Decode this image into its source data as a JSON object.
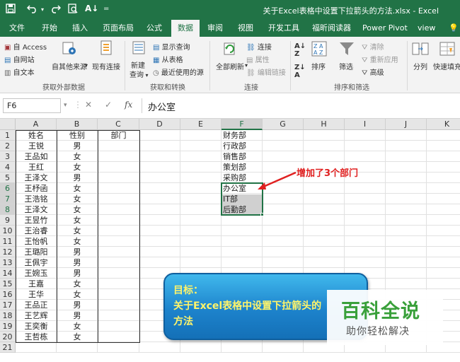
{
  "titlebar": {
    "title": "关于Excel表格中设置下拉箭头的方法.xlsx  -  Excel",
    "save_icon": "save-icon",
    "undo_icon": "undo-icon",
    "redo_icon": "redo-icon",
    "preview_icon": "print-preview-icon",
    "sort_icon": "sort-icon"
  },
  "tabs": [
    {
      "label": "文件"
    },
    {
      "label": "开始"
    },
    {
      "label": "插入"
    },
    {
      "label": "页面布局"
    },
    {
      "label": "公式"
    },
    {
      "label": "数据",
      "active": true
    },
    {
      "label": "审阅"
    },
    {
      "label": "视图"
    },
    {
      "label": "开发工具"
    },
    {
      "label": "福昕阅读器"
    },
    {
      "label": "Power Pivot"
    },
    {
      "label": "view"
    }
  ],
  "ribbon": {
    "get_external": {
      "access": "自 Access",
      "web": "自网站",
      "text": "自文本",
      "other": "自其他来源",
      "existing": "现有连接",
      "group": "获取外部数据"
    },
    "transform": {
      "new_query_1": "新建",
      "new_query_2": "查询",
      "show_queries": "显示查询",
      "from_table": "从表格",
      "recent_sources": "最近使用的源",
      "group": "获取和转换"
    },
    "connections": {
      "refresh_all": "全部刷新",
      "connections": "连接",
      "properties": "属性",
      "edit_links": "编辑链接",
      "group": "连接"
    },
    "sort_filter": {
      "sort": "排序",
      "filter": "筛选",
      "clear": "清除",
      "reapply": "重新应用",
      "advanced": "高级",
      "group": "排序和筛选"
    },
    "tools": {
      "split": "分列",
      "flash_fill": "快速填充"
    }
  },
  "formula_bar": {
    "name_box": "F6",
    "cancel": "✕",
    "enter": "✓",
    "fx": "fx",
    "value": "办公室"
  },
  "columns": [
    "A",
    "B",
    "C",
    "D",
    "E",
    "F",
    "G",
    "H",
    "I",
    "J",
    "K"
  ],
  "rows": [
    "1",
    "2",
    "3",
    "4",
    "5",
    "6",
    "7",
    "8",
    "9",
    "10",
    "11",
    "12",
    "13",
    "14",
    "15",
    "16",
    "17",
    "18",
    "19",
    "20",
    "21"
  ],
  "sheet": {
    "headers": {
      "name": "姓名",
      "gender": "性别",
      "dept": "部门"
    },
    "people": [
      {
        "name": "王锐",
        "gender": "男"
      },
      {
        "name": "王品如",
        "gender": "女"
      },
      {
        "name": "王红",
        "gender": "女"
      },
      {
        "name": "王泽文",
        "gender": "男"
      },
      {
        "name": "王杼函",
        "gender": "女"
      },
      {
        "name": "王浩铭",
        "gender": "女"
      },
      {
        "name": "王泽文",
        "gender": "女"
      },
      {
        "name": "王昱竹",
        "gender": "女"
      },
      {
        "name": "王治睿",
        "gender": "女"
      },
      {
        "name": "王怡帆",
        "gender": "女"
      },
      {
        "name": "王璐阳",
        "gender": "男"
      },
      {
        "name": "王佩宇",
        "gender": "男"
      },
      {
        "name": "王婉玉",
        "gender": "男"
      },
      {
        "name": "王嘉",
        "gender": "女"
      },
      {
        "name": "王华",
        "gender": "女"
      },
      {
        "name": "王品正",
        "gender": "男"
      },
      {
        "name": "王艺辉",
        "gender": "男"
      },
      {
        "name": "王奕衡",
        "gender": "女"
      },
      {
        "name": "王哲栋",
        "gender": "女"
      }
    ],
    "departments": [
      "财务部",
      "行政部",
      "销售部",
      "策划部",
      "采购部",
      "办公室",
      "IT部",
      "后勤部"
    ]
  },
  "annotation": "增加了3个部门",
  "callout": {
    "line1": "目标：",
    "line2": "关于Excel表格中设置下拉箭头的",
    "line3": "方法"
  },
  "watermark": {
    "title": "百科全说",
    "subtitle": "助你轻松解决"
  },
  "colors": {
    "excel_green": "#217346",
    "annotation_red": "#e02020",
    "callout_blue": "#1d83cc",
    "callout_text": "#fff46a",
    "watermark_green": "#39a03a"
  }
}
